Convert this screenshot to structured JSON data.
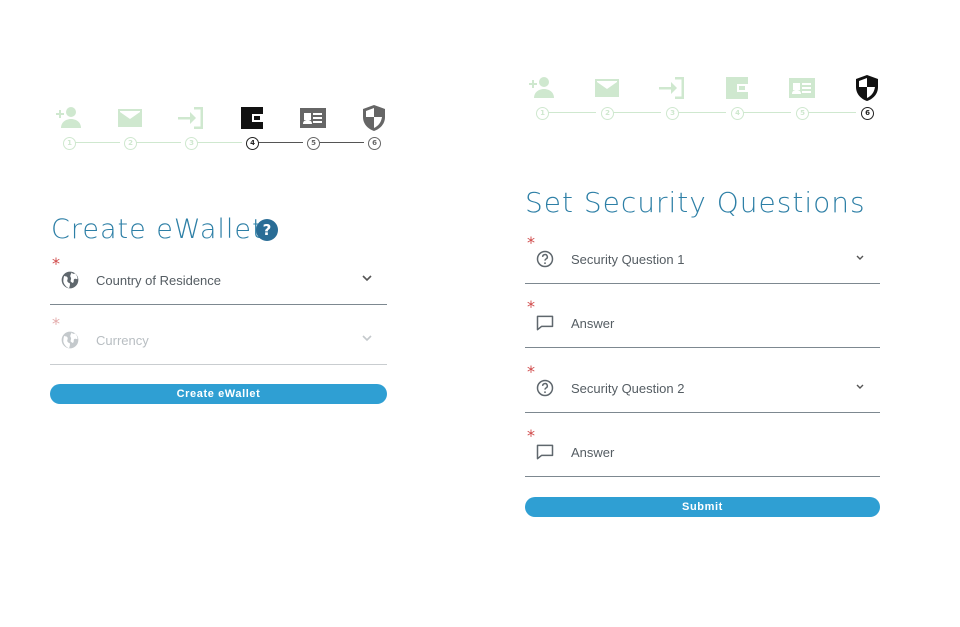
{
  "colors": {
    "title": "#2d7fa6",
    "button": "#2f9fd3",
    "step_done": "#cfe8cf",
    "step_active": "#111111",
    "step_pending": "#666666",
    "required": "#d04848"
  },
  "left": {
    "stepper": [
      {
        "icon": "add-user-icon",
        "number": "1",
        "state": "done"
      },
      {
        "icon": "mail-icon",
        "number": "2",
        "state": "done"
      },
      {
        "icon": "login-icon",
        "number": "3",
        "state": "done"
      },
      {
        "icon": "wallet-icon",
        "number": "4",
        "state": "active"
      },
      {
        "icon": "id-card-icon",
        "number": "5",
        "state": "pending"
      },
      {
        "icon": "shield-icon",
        "number": "6",
        "state": "pending"
      }
    ],
    "title": "Create eWallet",
    "help": "?",
    "fields": [
      {
        "label": "Country of Residence",
        "icon": "globe-icon",
        "required": "*"
      },
      {
        "label": "Currency",
        "icon": "globe-icon",
        "required": "*"
      }
    ],
    "button": "Create eWallet"
  },
  "right": {
    "stepper": [
      {
        "icon": "add-user-icon",
        "number": "1",
        "state": "done"
      },
      {
        "icon": "mail-icon",
        "number": "2",
        "state": "done"
      },
      {
        "icon": "login-icon",
        "number": "3",
        "state": "done"
      },
      {
        "icon": "wallet-icon",
        "number": "4",
        "state": "done"
      },
      {
        "icon": "id-card-icon",
        "number": "5",
        "state": "done"
      },
      {
        "icon": "shield-icon",
        "number": "6",
        "state": "active"
      }
    ],
    "title": "Set Security Questions",
    "fields": [
      {
        "label": "Security Question 1",
        "icon": "question-icon",
        "required": "*"
      },
      {
        "label": "Answer",
        "icon": "comment-icon",
        "required": "*"
      },
      {
        "label": "Security Question 2",
        "icon": "question-icon",
        "required": "*"
      },
      {
        "label": "Answer",
        "icon": "comment-icon",
        "required": "*"
      }
    ],
    "button": "Submit"
  }
}
